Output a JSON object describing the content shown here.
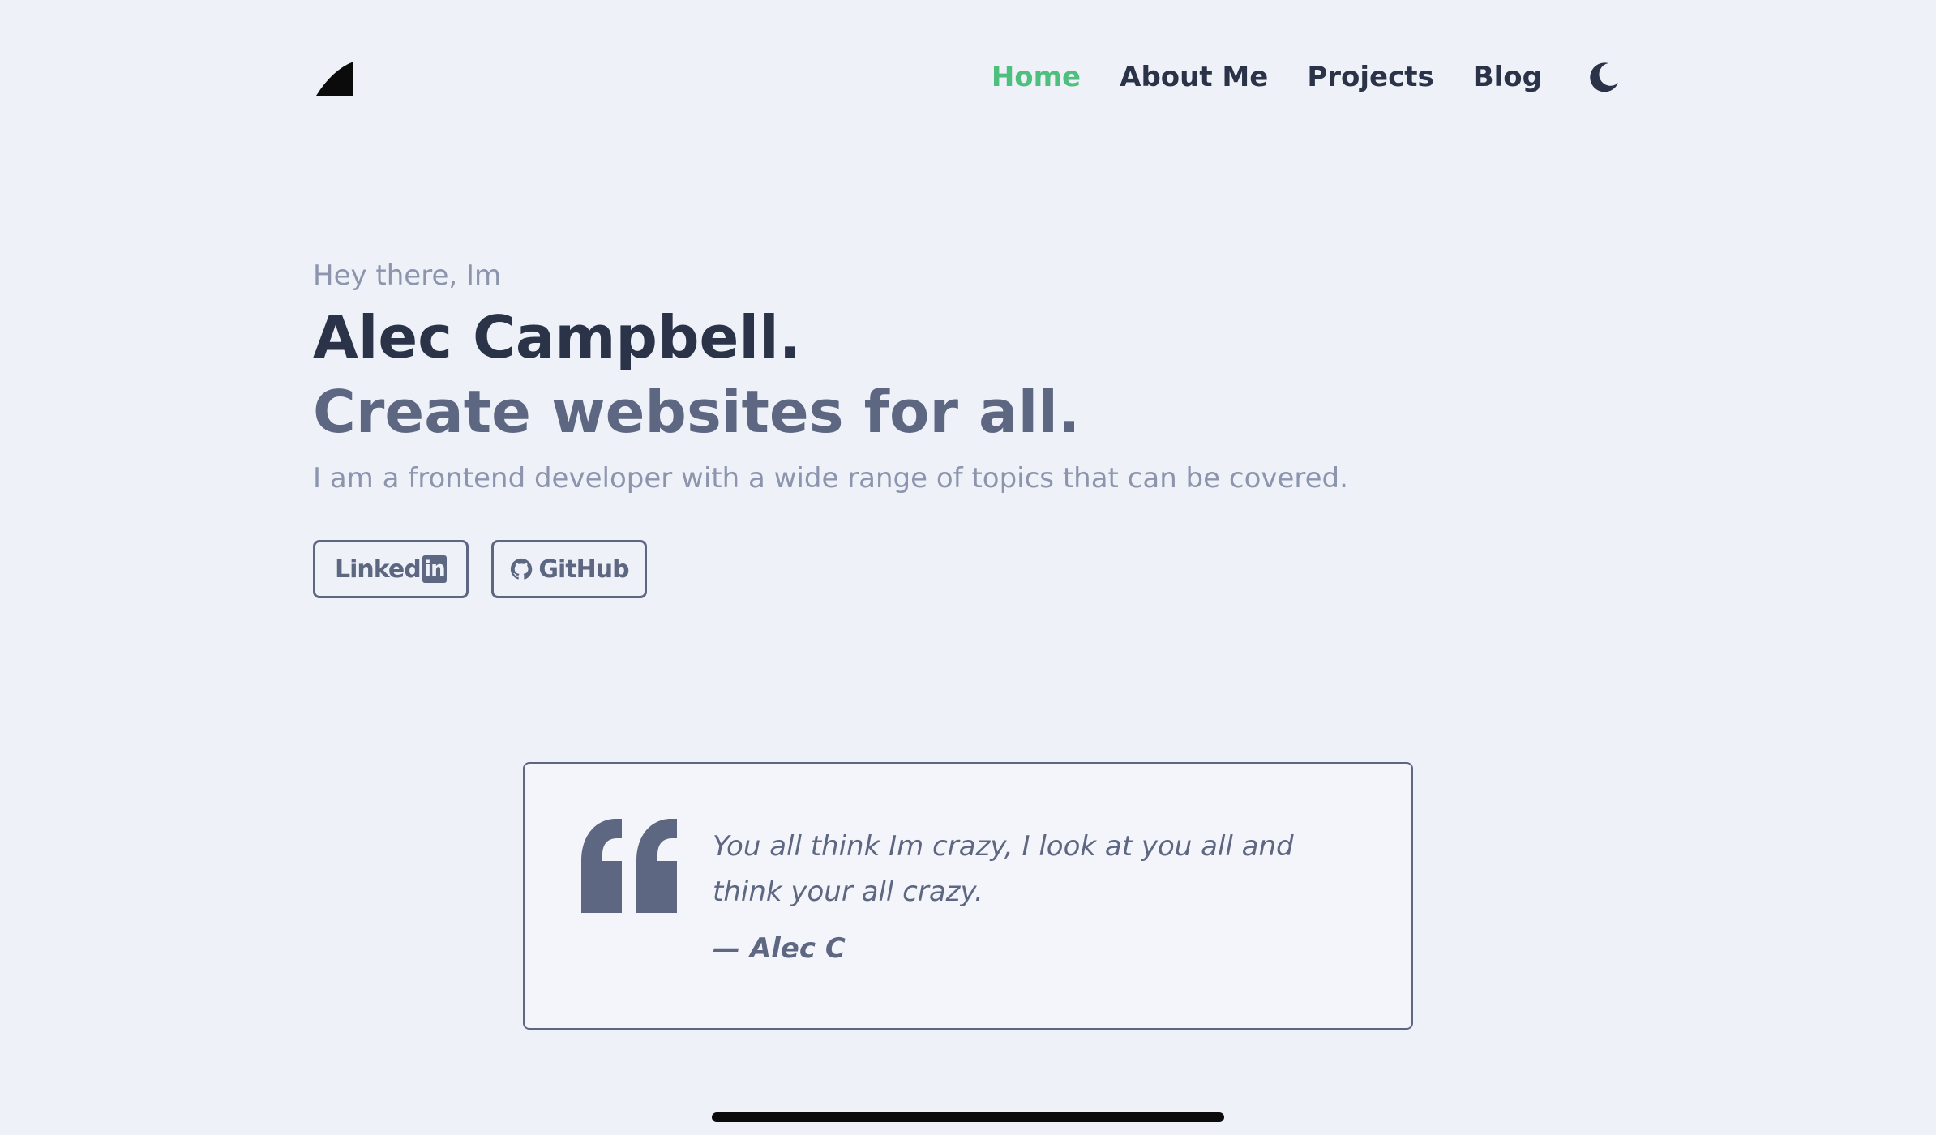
{
  "header": {
    "logo_icon": "triangle-logo-icon",
    "nav": [
      {
        "label": "Home",
        "active": true
      },
      {
        "label": "About Me",
        "active": false
      },
      {
        "label": "Projects",
        "active": false
      },
      {
        "label": "Blog",
        "active": false
      }
    ],
    "theme_toggle_icon": "moon-icon"
  },
  "hero": {
    "greeting": "Hey there, Im",
    "name": "Alec Campbell.",
    "tagline": "Create websites for all.",
    "bio": "I am a frontend developer with a wide range of topics that can be covered."
  },
  "socials": {
    "linkedin": {
      "label_text": "Linked",
      "label_box": "in",
      "icon": "linkedin-icon"
    },
    "github": {
      "label": "GitHub",
      "icon": "github-icon"
    }
  },
  "quote": {
    "icon": "quote-mark-icon",
    "text": "You all think Im crazy, I look at you all and think your all crazy.",
    "author": "— Alec C"
  },
  "colors": {
    "background": "#eef1f8",
    "accent": "#4ebf7d",
    "text_dark": "#2b3348",
    "text_muted": "#8c95ad",
    "text_mid": "#5d6782"
  }
}
